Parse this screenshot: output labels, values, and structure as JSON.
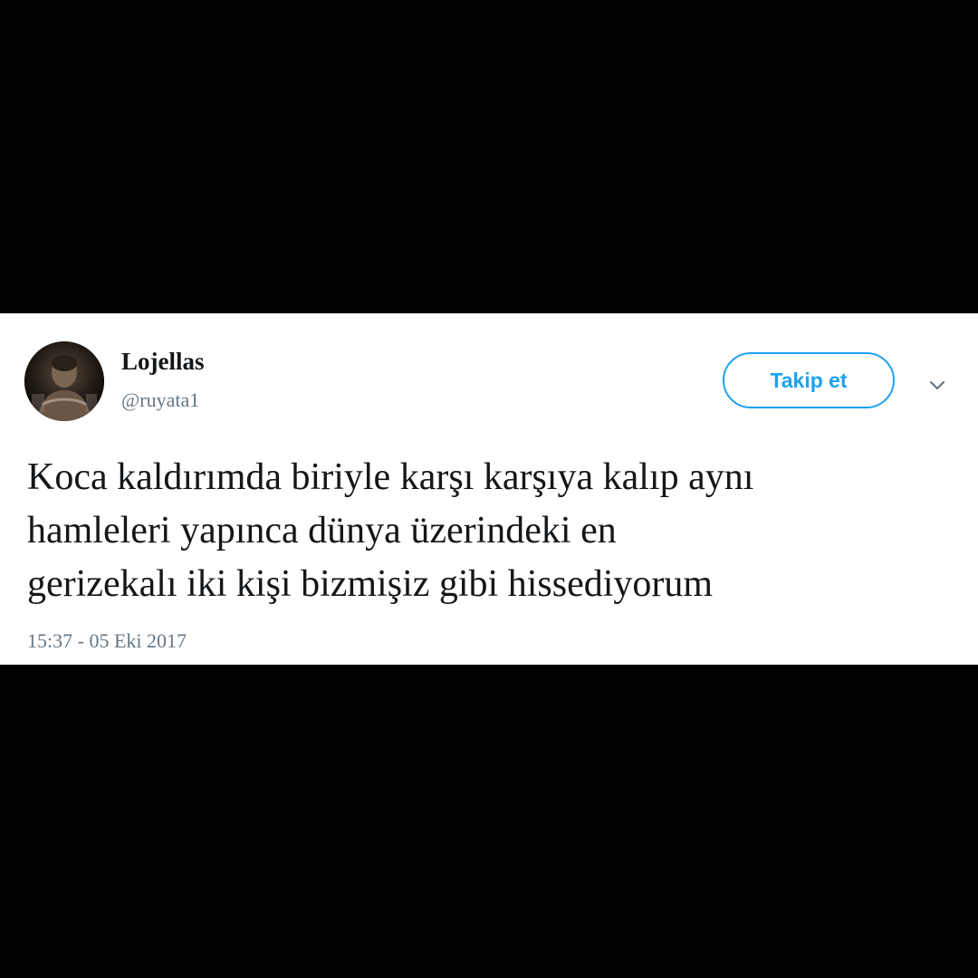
{
  "colors": {
    "background": "#000000",
    "card": "#ffffff",
    "accent": "#1da1f2",
    "text_primary": "#14171a",
    "text_secondary": "#657786"
  },
  "user": {
    "display_name": "Lojellas",
    "handle": "@ruyata1",
    "avatar_icon": "profile-photo-icon"
  },
  "actions": {
    "follow_label": "Takip et",
    "more_icon": "chevron-down-icon"
  },
  "tweet": {
    "text": "Koca kaldırımda biriyle karşı karşıya kalıp aynı\nhamleleri yapınca dünya üzerindeki en\ngerizekalı iki kişi bizmişiz gibi hissediyorum",
    "timestamp": "15:37 - 05 Eki 2017"
  }
}
